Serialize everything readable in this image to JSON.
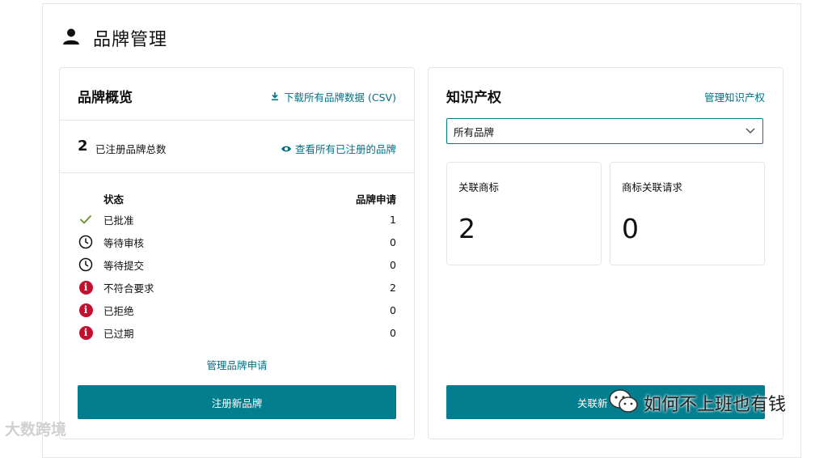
{
  "page": {
    "title": "品牌管理",
    "icon": "user-icon"
  },
  "overview": {
    "title": "品牌概览",
    "download_link": "下载所有品牌数据 (CSV)",
    "total_count": "2",
    "total_label": "已注册品牌总数",
    "view_link": "查看所有已注册的品牌",
    "col_status": "状态",
    "col_applications": "品牌申请",
    "rows": [
      {
        "icon": "check-icon",
        "label": "已批准",
        "value": "1"
      },
      {
        "icon": "clock-icon",
        "label": "等待审核",
        "value": "0"
      },
      {
        "icon": "clock-icon",
        "label": "等待提交",
        "value": "0"
      },
      {
        "icon": "info-icon",
        "label": "不符合要求",
        "value": "2"
      },
      {
        "icon": "info-icon",
        "label": "已拒绝",
        "value": "0"
      },
      {
        "icon": "info-icon",
        "label": "已过期",
        "value": "0"
      }
    ],
    "manage_link": "管理品牌申请",
    "register_button": "注册新品牌"
  },
  "ip": {
    "title": "知识产权",
    "manage_link": "管理知识产权",
    "select_value": "所有品牌",
    "linked_label": "关联商标",
    "linked_value": "2",
    "requests_label": "商标关联请求",
    "requests_value": "0",
    "button_label": "关联新"
  },
  "watermarks": {
    "right": "如何不上班也有钱",
    "left": "大数跨境"
  },
  "colors": {
    "accent": "#047e8e",
    "link": "#007185",
    "alert": "#c40f2f",
    "check": "#6b8e23"
  }
}
